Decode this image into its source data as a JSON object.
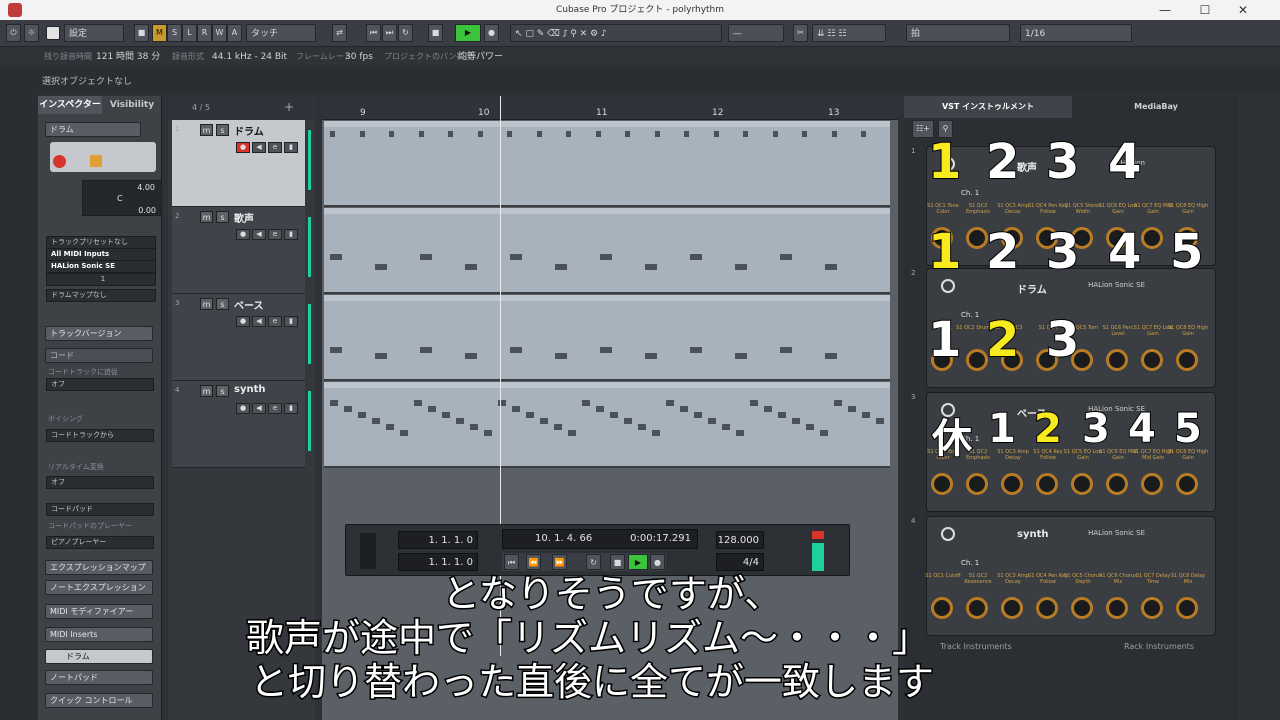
{
  "window": {
    "title": "Cubase Pro プロジェクト - polyrhythm"
  },
  "toolbar": {
    "preset": "設定",
    "modes": [
      "M",
      "S",
      "L",
      "R",
      "W",
      "A"
    ],
    "automation": "タッチ",
    "grid_label": "拍",
    "quantize": "1/16"
  },
  "info": {
    "rec_time_label": "残り録音時間",
    "rec_time": "121 時間 38 分",
    "rec_format_label": "録音形式",
    "rec_format": "44.1 kHz - 24 Bit",
    "frame_rate_label": "フレームレート",
    "frame_rate": "30 fps",
    "pan_label": "プロジェクトのパン補正",
    "pan": "均等パワー",
    "selection": "選択オブジェクトなし"
  },
  "inspector": {
    "tab_inspector": "インスペクター",
    "tab_visibility": "Visibility",
    "track": "ドラム",
    "vol": "4.00",
    "pan": "C",
    "delay": "0.00",
    "preset": "トラックプリセットなし",
    "midi_in": "All MIDI Inputs",
    "instrument": "HALion Sonic SE",
    "channel": "1",
    "drum_map": "ドラムマップなし",
    "track_versions": "トラックバージョン",
    "chords": "コード",
    "chord_track_follow": "コードトラックに追従",
    "off1": "オフ",
    "voicing": "ボイシング",
    "voicing_val": "コードトラックから",
    "realtime": "リアルタイム変換",
    "off2": "オフ",
    "chord_pad": "コードパッド",
    "chord_pad_player": "コードパッドのプレーヤー",
    "piano_player": "ピアノプレーヤー",
    "expression_map": "エクスプレッションマップ",
    "note_expression": "ノートエクスプレッション",
    "midi_modifier": "MIDI モディファイアー",
    "midi_inserts": "MIDI Inserts",
    "drum": "ドラム",
    "note_pad": "ノートパッド",
    "quick_control": "クイック コントロール"
  },
  "tracklist": {
    "count": "4 / 5",
    "tracks": [
      {
        "num": "1",
        "name": "ドラム"
      },
      {
        "num": "2",
        "name": "歌声"
      },
      {
        "num": "3",
        "name": "ベース"
      },
      {
        "num": "4",
        "name": "synth"
      }
    ]
  },
  "ruler": {
    "bars": [
      "9",
      "10",
      "11",
      "12",
      "13"
    ]
  },
  "transport": {
    "left_loc": "1. 1. 1.   0",
    "right_loc": "1. 1. 1.   0",
    "position": "10.  1.  4.  66",
    "time": "0:00:17.291",
    "tempo": "128.000",
    "signature": "4/4"
  },
  "rightzone": {
    "tab_vst": "VST インストゥルメント",
    "tab_media": "MediaBay",
    "footer_left": "Track Instruments",
    "footer_right": "Rack Instruments"
  },
  "slots": [
    {
      "num": "1",
      "name": "歌声",
      "sub": "HALion",
      "ch": "Ch. 1",
      "labels": [
        "S1 QC1 Tone Color",
        "S1 QC2 Emphasis",
        "S1 QC3 Amp Decay",
        "S1 QC4 Pen Key Follow",
        "S1 QC5 Stereo Width",
        "S1 QC6 EQ Low Gain",
        "S1 QC7 EQ Mid Gain",
        "S1 QC8 EQ High Gain"
      ]
    },
    {
      "num": "2",
      "name": "ドラム",
      "sub": "HALion Sonic SE",
      "ch": "Ch. 1",
      "labels": [
        "S1 QC1",
        "S1 QC2 Drum Sat",
        "S1 QC3",
        "S1 QC4",
        "S1 QC5 Tom",
        "S1 QC6 Perc Level",
        "S1 QC7 EQ Low Gain",
        "S1 QC8 EQ High Gain"
      ]
    },
    {
      "num": "3",
      "name": "ベース",
      "sub": "HALion Sonic SE",
      "ch": "Ch. 1",
      "labels": [
        "S1 QC1 Tone Color",
        "S1 QC2 Emphasis",
        "S1 QC3 Amp Decay",
        "S1 QC4 Key Follow",
        "S1 QC5 EQ Low Gain",
        "S1 QC6 EQ Mid Gain",
        "S1 QC7 EQ High Mid Gain",
        "S1 QC8 EQ High Gain"
      ]
    },
    {
      "num": "4",
      "name": "synth",
      "sub": "HALion Sonic SE",
      "ch": "Ch. 1",
      "labels": [
        "S1 QC1 Cutoff",
        "S1 QC2 Resonance",
        "S1 QC3 Amp Decay",
        "S1 QC4 Pen Key Follow",
        "S1 QC5 Chorus Depth",
        "S1 QC6 Chorus Mix",
        "S1 QC7 Delay Time",
        "S1 QC8 Delay Mix"
      ]
    }
  ],
  "overlay": {
    "row1": [
      "1",
      "2",
      "3",
      "4"
    ],
    "row2": [
      "1",
      "2",
      "3",
      "4",
      "5"
    ],
    "row3": [
      "1",
      "2",
      "3"
    ],
    "row4": [
      "休",
      "1",
      "2",
      "3",
      "4",
      "5"
    ],
    "subtitle1": "となりそうですが、",
    "subtitle2": "歌声が途中で「リズムリズム～・・・」",
    "subtitle3": "と切り替わった直後に全てが一致します"
  },
  "colors": {
    "accent": "#f7ea1f",
    "meter": "#1fcf9c",
    "knob_ring": "#b87c26",
    "record": "#d8342c",
    "play": "#3bc43b"
  }
}
